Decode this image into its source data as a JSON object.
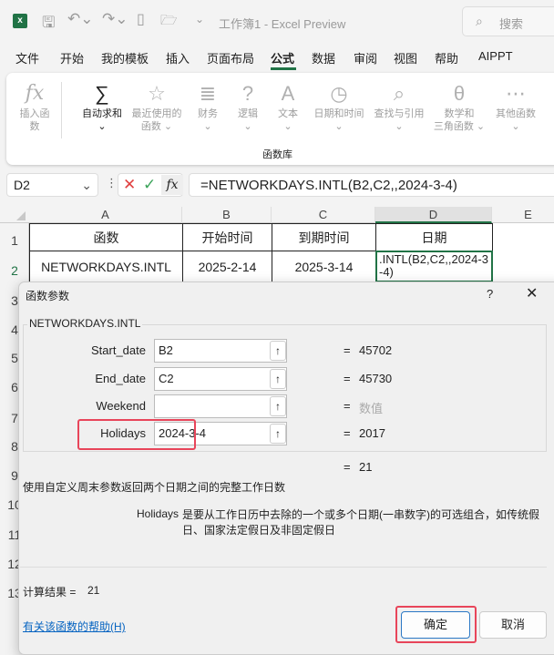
{
  "titlebar": {
    "title": "工作簿1 - Excel Preview",
    "search_placeholder": "搜索",
    "app_icon_letter": "x"
  },
  "menu": [
    "文件",
    "开始",
    "我的模板",
    "插入",
    "页面布局",
    "公式",
    "数据",
    "审阅",
    "视图",
    "帮助",
    "AIPPT"
  ],
  "active_menu": "公式",
  "ribbon": {
    "group_label": "函数库",
    "buttons": [
      {
        "l1": "插入函数",
        "l2": "",
        "icon": "fx",
        "enabled": false
      },
      {
        "l1": "自动求和",
        "l2": "⌄",
        "icon": "∑",
        "enabled": true
      },
      {
        "l1": "最近使用的",
        "l2": "函数 ⌄",
        "icon": "☆",
        "enabled": false
      },
      {
        "l1": "财务",
        "l2": "⌄",
        "icon": "≣",
        "enabled": false
      },
      {
        "l1": "逻辑",
        "l2": "⌄",
        "icon": "?",
        "enabled": false
      },
      {
        "l1": "文本",
        "l2": "⌄",
        "icon": "A",
        "enabled": false
      },
      {
        "l1": "日期和时间",
        "l2": "⌄",
        "icon": "◷",
        "enabled": false
      },
      {
        "l1": "查找与引用",
        "l2": "⌄",
        "icon": "⌕",
        "enabled": false
      },
      {
        "l1": "数学和",
        "l2": "三角函数 ⌄",
        "icon": "θ",
        "enabled": false
      },
      {
        "l1": "其他函数",
        "l2": "⌄",
        "icon": "⋯",
        "enabled": false
      }
    ]
  },
  "formula_bar": {
    "name_box": "D2",
    "formula": "=NETWORKDAYS.INTL(B2,C2,,2024-3-4)"
  },
  "grid": {
    "columns": [
      "A",
      "B",
      "C",
      "D",
      "E"
    ],
    "rows": [
      "1",
      "2",
      "3",
      "4",
      "5",
      "6",
      "7",
      "8",
      "9",
      "10",
      "11",
      "12",
      "13"
    ],
    "row1": [
      "函数",
      "开始时间",
      "到期时间",
      "日期"
    ],
    "row2": [
      "NETWORKDAYS.INTL",
      "2025-2-14",
      "2025-3-14",
      ".INTL(B2,C2,,2024-3-4)"
    ]
  },
  "dialog": {
    "title": "函数参数",
    "help_glyph": "?",
    "function_name": "NETWORKDAYS.INTL",
    "args": [
      {
        "label": "Start_date",
        "value": "B2",
        "result": "45702"
      },
      {
        "label": "End_date",
        "value": "C2",
        "result": "45730"
      },
      {
        "label": "Weekend",
        "value": "",
        "result": "数值"
      },
      {
        "label": "Holidays",
        "value": "2024-3-4",
        "result": "2017"
      }
    ],
    "eq": "=",
    "total": "21",
    "description": "使用自定义周末参数返回两个日期之间的完整工作日数",
    "arg_help_name": "Holidays",
    "arg_help_text": "是要从工作日历中去除的一个或多个日期(一串数字)的可选组合，如传统假日、国家法定假日及非固定假日",
    "calc_label": "计算结果 =",
    "calc_value": "21",
    "help_link": "有关该函数的帮助(H)",
    "ok": "确定",
    "cancel": "取消"
  },
  "colors": {
    "excel_green": "#217346",
    "highlight": "#e8455a",
    "link": "#0563c1"
  }
}
